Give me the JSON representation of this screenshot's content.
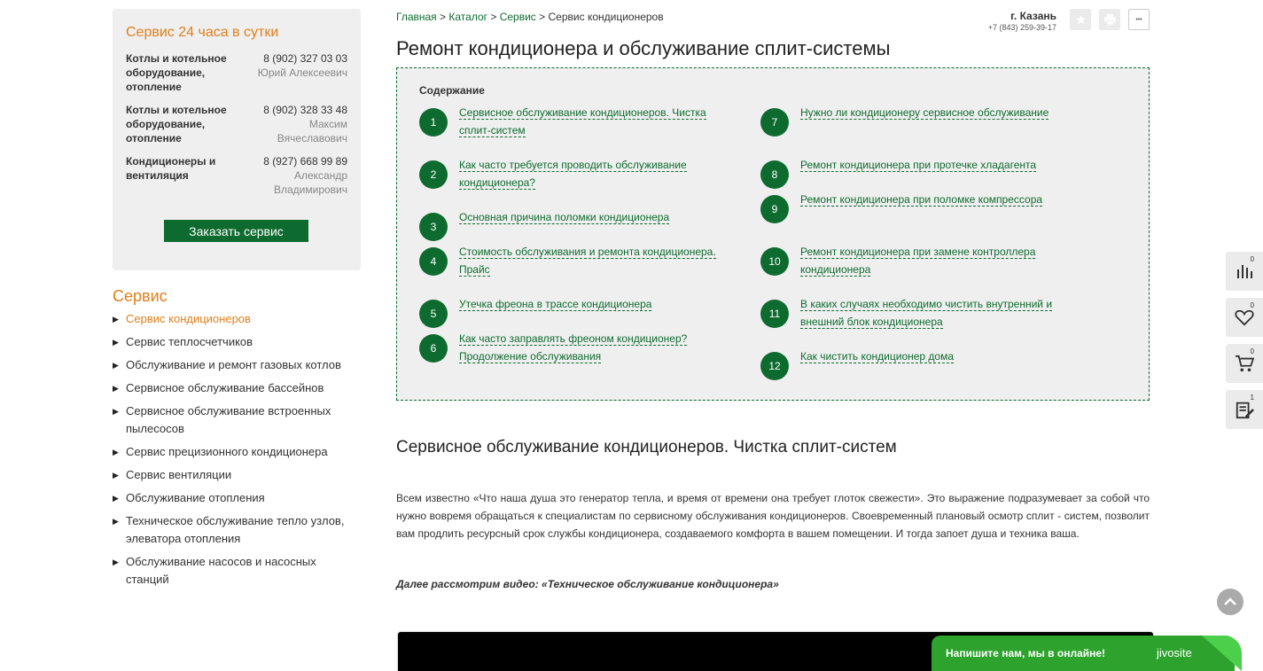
{
  "service_box": {
    "title": "Сервис 24 часа в сутки",
    "contacts": [
      {
        "dept": "Котлы и котельное оборудование, отопление",
        "phone": "8 (902) 327 03 03",
        "person": "Юрий Алексеевич"
      },
      {
        "dept": "Котлы и котельное оборудование, отопление",
        "phone": "8 (902) 328 33 48",
        "person": "Максим Вячеславович"
      },
      {
        "dept": "Кондиционеры и вентиляция",
        "phone": "8 (927) 668 99 89",
        "person": "Александр Владимирович"
      }
    ],
    "order_button": "Заказать сервис"
  },
  "sidebar": {
    "heading": "Сервис",
    "items": [
      {
        "label": "Сервис кондиционеров"
      },
      {
        "label": "Сервис теплосчетчиков"
      },
      {
        "label": "Обслуживание и ремонт газовых котлов"
      },
      {
        "label": "Сервисное обслуживание бассейнов"
      },
      {
        "label": "Сервисное обслуживание встроенных пылесосов"
      },
      {
        "label": "Сервис прецизионного кондиционера"
      },
      {
        "label": "Сервис вентиляции"
      },
      {
        "label": "Обслуживание отопления"
      },
      {
        "label": "Техническое обслуживание тепло узлов, элеватора отопления"
      },
      {
        "label": "Обслуживание насосов и насосных станций"
      }
    ]
  },
  "breadcrumb": {
    "home": "Главная",
    "sep": ">",
    "catalog": "Каталог",
    "service": "Сервис",
    "current": "Сервис кондиционеров"
  },
  "header": {
    "city": "г. Казань",
    "phone": "+7 (843) 259-39-17",
    "more_label": "•••"
  },
  "page_title": "Ремонт кондиционера и обслуживание сплит-системы",
  "toc": {
    "title": "Содержание",
    "items": [
      {
        "num": "1",
        "text": "Сервисное обслуживание кондиционеров. Чистка сплит-систем"
      },
      {
        "num": "2",
        "text": "Как часто требуется проводить обслуживание кондиционера?"
      },
      {
        "num": "3",
        "text": "Основная причина поломки кондиционера"
      },
      {
        "num": "4",
        "text": "Стоимость обслуживания и ремонта кондиционера. Прайс"
      },
      {
        "num": "5",
        "text": "Утечка фреона в трассе кондиционера"
      },
      {
        "num": "6",
        "text": "Как часто заправлять фреоном кондиционер? Продолжение обслуживания"
      },
      {
        "num": "7",
        "text": "Нужно ли кондиционеру сервисное обслуживание"
      },
      {
        "num": "8",
        "text": "Ремонт кондиционера при протечке хладагента"
      },
      {
        "num": "9",
        "text": "Ремонт кондиционера при поломке компрессора"
      },
      {
        "num": "10",
        "text": "Ремонт кондиционера при замене контроллера кондиционера"
      },
      {
        "num": "11",
        "text": "В каких случаях необходимо чистить внутренний и внешний блок кондиционера"
      },
      {
        "num": "12",
        "text": "Как чистить кондиционер дома"
      }
    ]
  },
  "section_title": "Сервисное обслуживание кондиционеров. Чистка сплит-систем",
  "article_text": "Всем известно «Что наша душа это генератор тепла, и время от времени она требует глоток свежести». Это выражение подразумевает за собой что нужно вовремя обращаться к специалистам по сервисному обслуживания кондиционеров. Своевременный плановый осмотр сплит - систем, позволит вам продлить ресурсный срок службы кондиционера, создаваемого комфорта в вашем помещении. И тогда запоет душа и техника ваша.",
  "video_note": "Далее рассмотрим видео: «Техническое обслуживание кондиционера»",
  "side_panel": {
    "compare_count": "0",
    "favorites_count": "0",
    "cart_count": "0",
    "orders_count": "1"
  },
  "chat": {
    "text": "Напишите нам, мы в онлайне!",
    "brand": "jivosite"
  },
  "colors": {
    "accent_green": "#0e6b2f",
    "accent_orange": "#e07f1a",
    "chat_green": "#2da32d"
  }
}
